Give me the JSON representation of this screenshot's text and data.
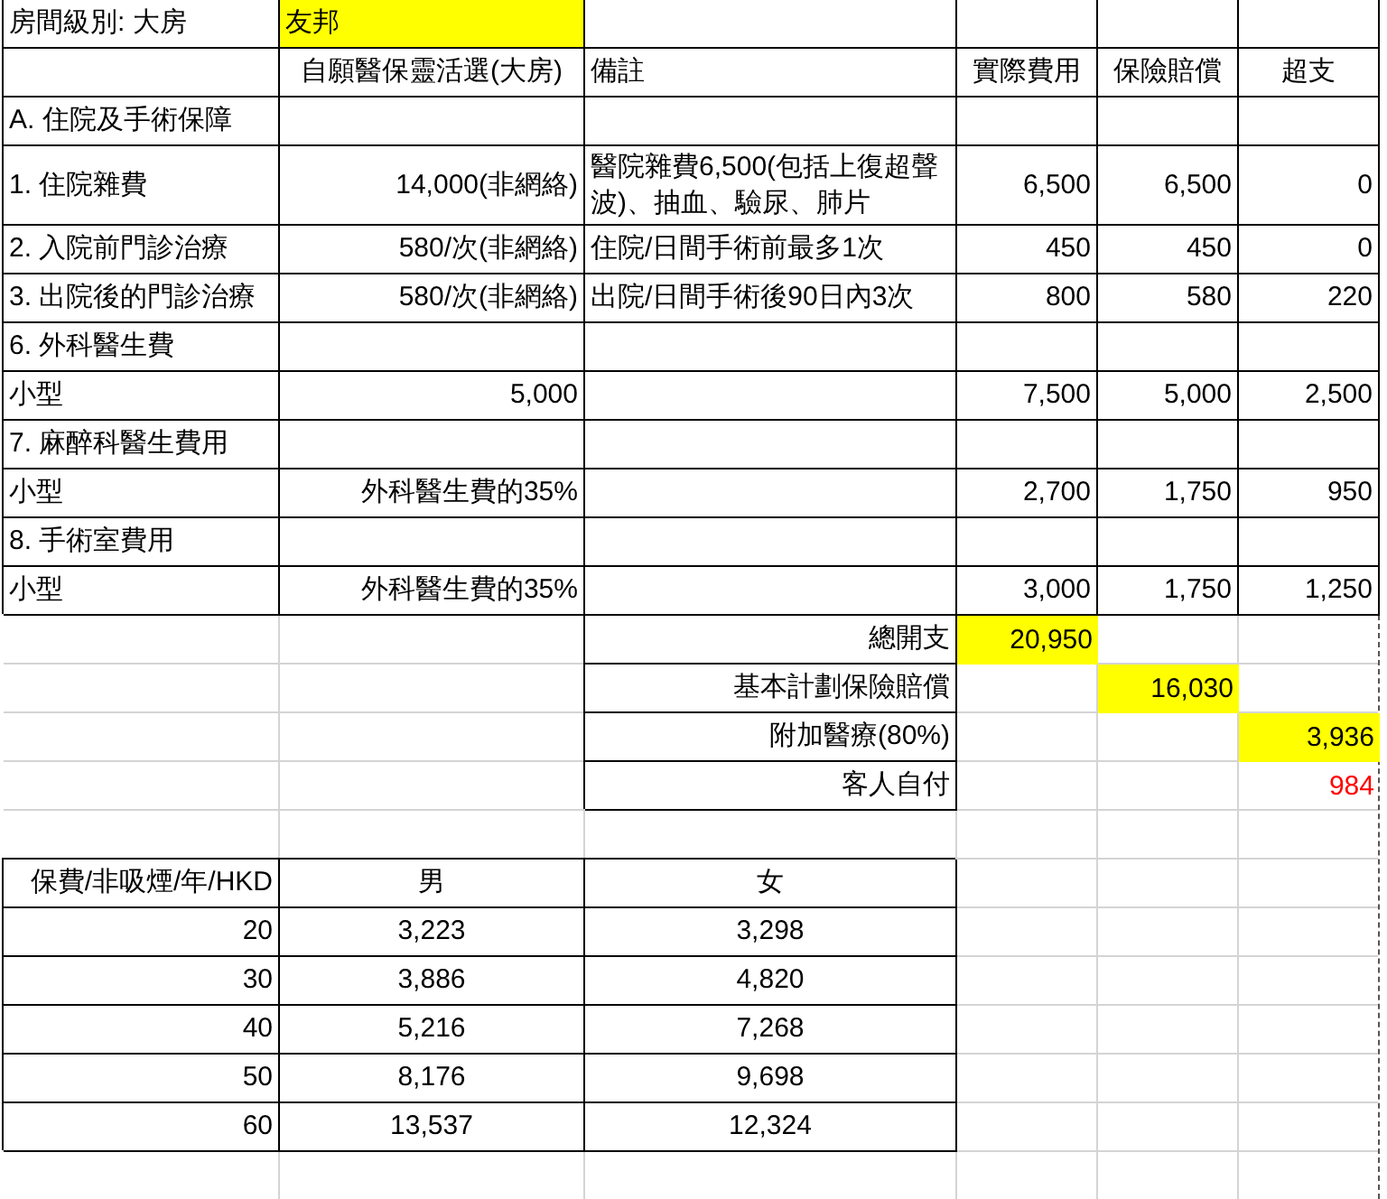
{
  "cost_table": {
    "rows": [
      [
        {
          "text": "房間級別: 大房",
          "kind": "text",
          "highlighted": false
        },
        {
          "text": "友邦",
          "kind": "text",
          "highlighted": true
        },
        null,
        null,
        null,
        null
      ],
      [
        null,
        {
          "text": "自願醫保靈活選(大房)",
          "kind": "heading",
          "highlighted": false
        },
        {
          "text": "備註",
          "kind": "text",
          "highlighted": false
        },
        {
          "text": "實際費用",
          "kind": "heading",
          "highlighted": false
        },
        {
          "text": "保險賠償",
          "kind": "heading",
          "highlighted": false
        },
        {
          "text": "超支",
          "kind": "heading",
          "highlighted": false
        }
      ],
      [
        {
          "text": "A. 住院及手術保障",
          "kind": "text",
          "highlighted": false
        },
        null,
        null,
        null,
        null,
        null
      ],
      [
        {
          "text": "1. 住院雜費",
          "kind": "text",
          "highlighted": false
        },
        {
          "text": "14,000(非網絡)",
          "kind": "number",
          "highlighted": false
        },
        {
          "text": "醫院雜費6,500(包括上復超聲波)、抽血、驗尿、肺片",
          "kind": "text",
          "highlighted": false
        },
        {
          "text": "6,500",
          "kind": "number",
          "highlighted": false
        },
        {
          "text": "6,500",
          "kind": "number",
          "highlighted": false
        },
        {
          "text": "0",
          "kind": "number",
          "highlighted": false
        }
      ],
      [
        {
          "text": "2. 入院前門診治療",
          "kind": "text",
          "highlighted": false
        },
        {
          "text": "580/次(非網絡)",
          "kind": "number",
          "highlighted": false
        },
        {
          "text": "住院/日間手術前最多1次",
          "kind": "text",
          "highlighted": false
        },
        {
          "text": "450",
          "kind": "number",
          "highlighted": false
        },
        {
          "text": "450",
          "kind": "number",
          "highlighted": false
        },
        {
          "text": "0",
          "kind": "number",
          "highlighted": false
        }
      ],
      [
        {
          "text": "3. 出院後的門診治療",
          "kind": "text",
          "highlighted": false
        },
        {
          "text": "580/次(非網絡)",
          "kind": "number",
          "highlighted": false
        },
        {
          "text": "出院/日間手術後90日內3次",
          "kind": "text",
          "highlighted": false
        },
        {
          "text": "800",
          "kind": "number",
          "highlighted": false
        },
        {
          "text": "580",
          "kind": "number",
          "highlighted": false
        },
        {
          "text": "220",
          "kind": "number",
          "highlighted": false
        }
      ],
      [
        {
          "text": "6. 外科醫生費",
          "kind": "text",
          "highlighted": false
        },
        null,
        null,
        null,
        null,
        null
      ],
      [
        {
          "text": "小型",
          "kind": "text",
          "highlighted": false
        },
        {
          "text": "5,000",
          "kind": "number",
          "highlighted": false
        },
        null,
        {
          "text": "7,500",
          "kind": "number",
          "highlighted": false
        },
        {
          "text": "5,000",
          "kind": "number",
          "highlighted": false
        },
        {
          "text": "2,500",
          "kind": "number",
          "highlighted": false
        }
      ],
      [
        {
          "text": "7. 麻醉科醫生費用",
          "kind": "text",
          "highlighted": false
        },
        null,
        null,
        null,
        null,
        null
      ],
      [
        {
          "text": "小型",
          "kind": "text",
          "highlighted": false
        },
        {
          "text": "外科醫生費的35%",
          "kind": "number",
          "highlighted": false
        },
        null,
        {
          "text": "2,700",
          "kind": "number",
          "highlighted": false
        },
        {
          "text": "1,750",
          "kind": "number",
          "highlighted": false
        },
        {
          "text": "950",
          "kind": "number",
          "highlighted": false
        }
      ],
      [
        {
          "text": "8. 手術室費用",
          "kind": "text",
          "highlighted": false
        },
        null,
        null,
        null,
        null,
        null
      ],
      [
        {
          "text": "小型",
          "kind": "text",
          "highlighted": false
        },
        {
          "text": "外科醫生費的35%",
          "kind": "number",
          "highlighted": false
        },
        null,
        {
          "text": "3,000",
          "kind": "number",
          "highlighted": false
        },
        {
          "text": "1,750",
          "kind": "number",
          "highlighted": false
        },
        {
          "text": "1,250",
          "kind": "number",
          "highlighted": false
        }
      ]
    ]
  },
  "summary": [
    {
      "label": "總開支",
      "actual_cost": {
        "text": "20,950",
        "highlighted": true,
        "color": "#000000"
      }
    },
    {
      "label": "基本計劃保險賠償",
      "insurance_payout": {
        "text": "16,030",
        "highlighted": true,
        "color": "#000000"
      }
    },
    {
      "label": "附加醫療(80%)",
      "excess": {
        "text": "3,936",
        "highlighted": true,
        "color": "#000000"
      }
    },
    {
      "label": "客人自付",
      "excess": {
        "text": "984",
        "highlighted": false,
        "color": "#ff0000"
      }
    }
  ],
  "premium_table": {
    "columns": [
      "保費/非吸煙/年/HKD",
      "男",
      "女"
    ],
    "rows": [
      [
        "20",
        "3,223",
        "3,298"
      ],
      [
        "30",
        "3,886",
        "4,820"
      ],
      [
        "40",
        "5,216",
        "7,268"
      ],
      [
        "50",
        "8,176",
        "9,698"
      ],
      [
        "60",
        "13,537",
        "12,324"
      ]
    ]
  }
}
